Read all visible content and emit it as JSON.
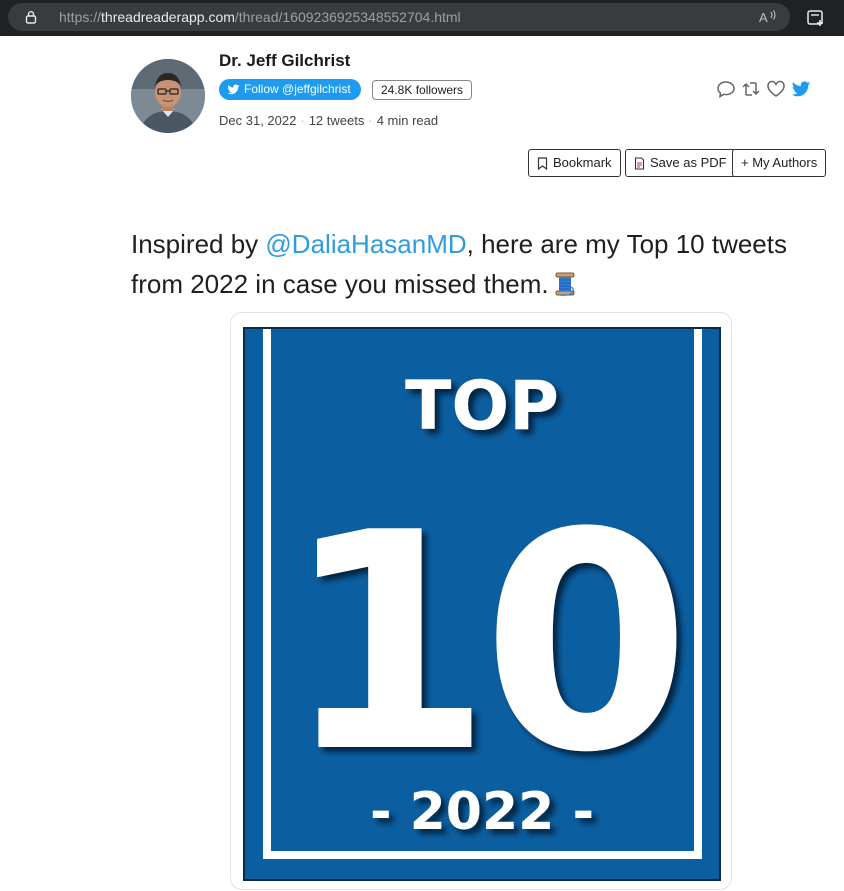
{
  "browser": {
    "url_scheme": "https://",
    "url_host": "threadreaderapp.com",
    "url_path": "/thread/1609236925348552704.html"
  },
  "author": {
    "name": "Dr. Jeff Gilchrist",
    "follow_label": "Follow @jeffgilchrist",
    "followers": "24.8K followers",
    "date": "Dec 31, 2022",
    "tweets": "12 tweets",
    "read_time": "4 min read"
  },
  "actions": {
    "bookmark": "Bookmark",
    "save_pdf": "Save as PDF",
    "my_authors": "+ My Authors"
  },
  "tweet": {
    "text_before": "Inspired by ",
    "mention": "@DaliaHasanMD",
    "text_after": ", here are my Top 10 tweets from 2022 in case you missed them."
  },
  "image": {
    "line1": "TOP",
    "line2": "10",
    "line3": "- 2022 -"
  },
  "colors": {
    "twitter_blue": "#1d9bf0",
    "mention_blue": "#2f9be0",
    "poster_blue": "#0b5fa0"
  },
  "icons": [
    "lock-icon",
    "read-aloud-icon",
    "collections-icon",
    "twitter-bird-icon",
    "reply-icon",
    "retweet-icon",
    "like-icon",
    "bookmark-icon",
    "pdf-icon",
    "thread-spool-icon"
  ]
}
